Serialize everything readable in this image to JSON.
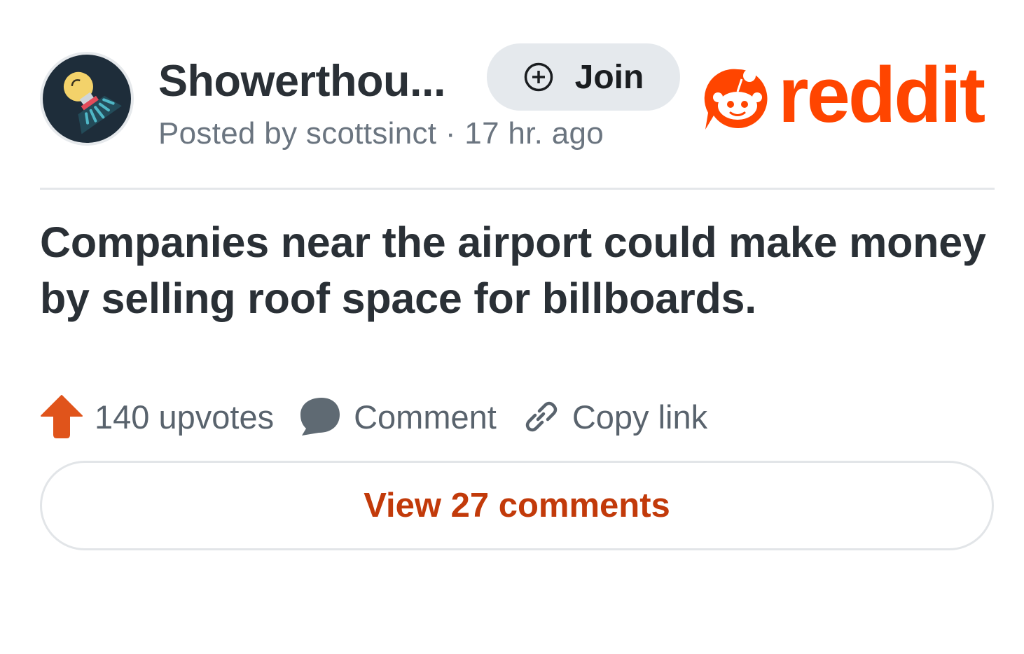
{
  "post": {
    "subreddit_name": "Showerthou...",
    "meta": "Posted by scottsinct · 17 hr. ago",
    "title": "Companies near the airport could make money by selling roof space for billboards."
  },
  "join_button": {
    "label": "Join",
    "icon": "plus-circle-icon"
  },
  "brand": {
    "wordmark": "reddit",
    "color": "#ff4500"
  },
  "actions": [
    {
      "icon": "upvote-arrow-icon",
      "label": "140 upvotes",
      "color": "#e0541b"
    },
    {
      "icon": "comment-bubble-icon",
      "label": "Comment"
    },
    {
      "icon": "link-icon",
      "label": "Copy link"
    }
  ],
  "view_comments": {
    "label": "View 27 comments",
    "color": "#c23a0a"
  }
}
